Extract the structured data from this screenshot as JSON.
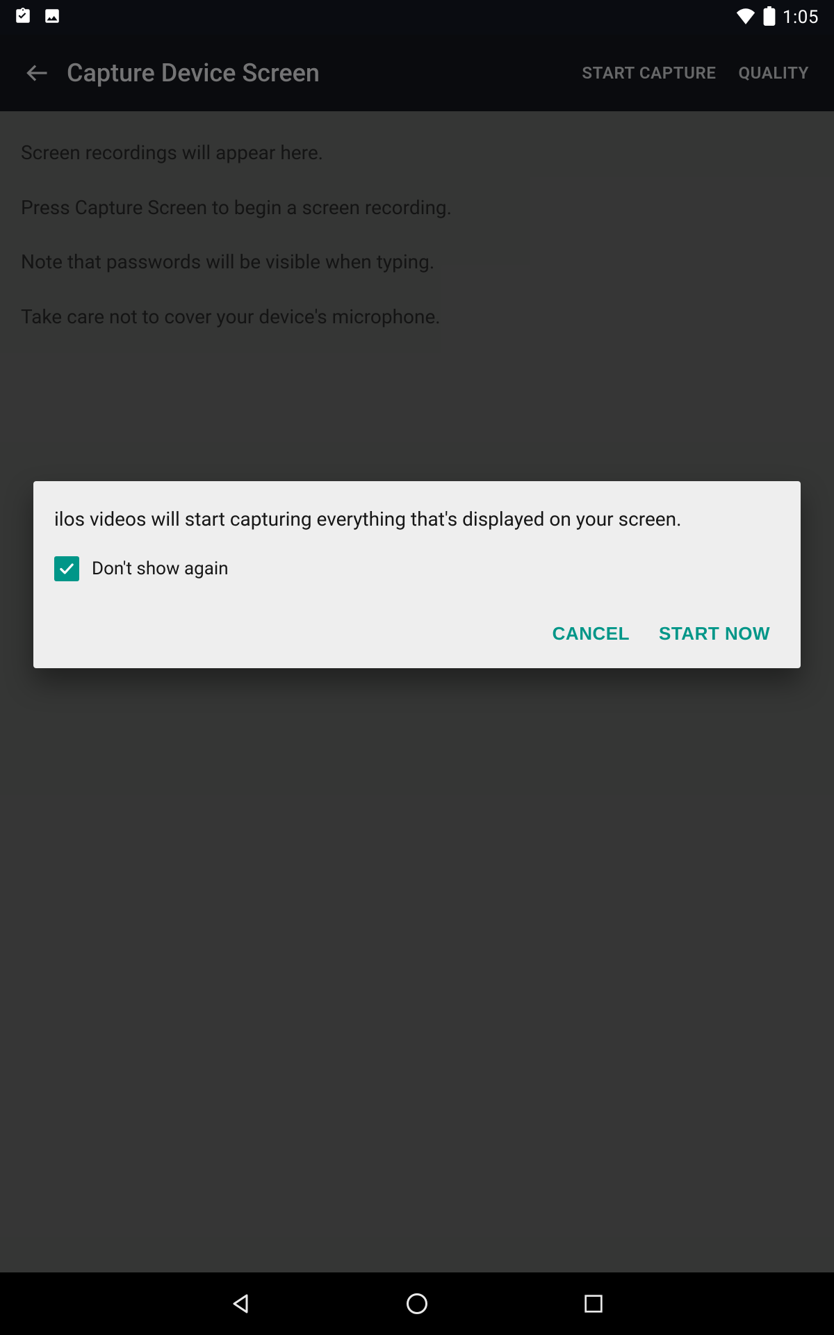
{
  "status": {
    "time": "1:05"
  },
  "appbar": {
    "title": "Capture Device Screen",
    "start_capture": "START CAPTURE",
    "quality": "QUALITY"
  },
  "content": {
    "line1": "Screen recordings will appear here.",
    "line2": "Press Capture Screen to begin a screen recording.",
    "line3": "Note that passwords will be visible when typing.",
    "line4": "Take care not to cover your device's microphone."
  },
  "dialog": {
    "message": "ilos videos will start capturing everything that's displayed on your screen.",
    "dont_show": "Don't show again",
    "cancel": "CANCEL",
    "start_now": "START NOW"
  },
  "colors": {
    "accent": "#009688"
  }
}
